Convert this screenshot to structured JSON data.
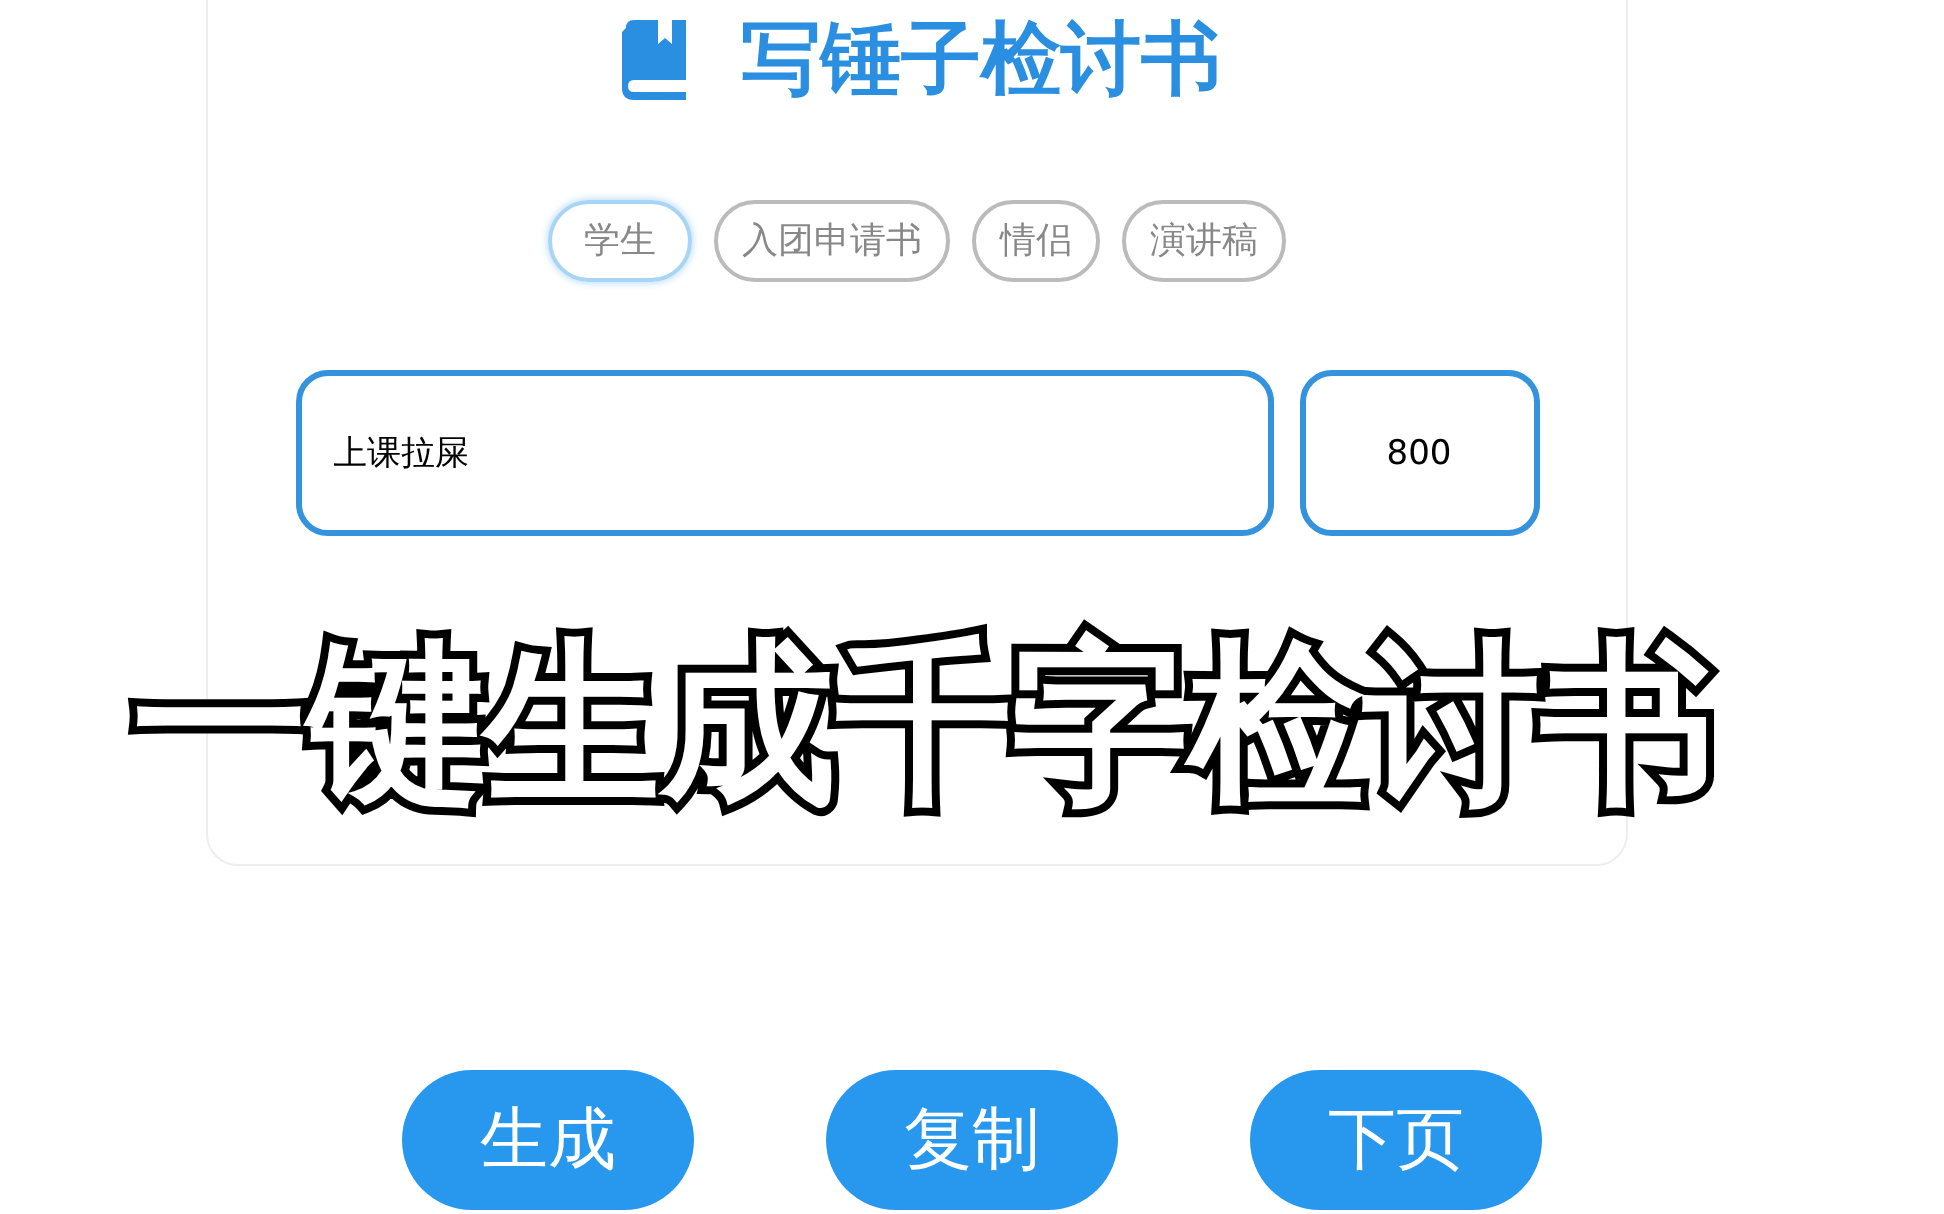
{
  "app": {
    "title": "写锤子检讨书"
  },
  "tabs": [
    {
      "label": "学生",
      "selected": true
    },
    {
      "label": "入团申请书",
      "selected": false
    },
    {
      "label": "情侣",
      "selected": false
    },
    {
      "label": "演讲稿",
      "selected": false
    }
  ],
  "topic_field": {
    "value": "上课拉屎"
  },
  "word_count_field": {
    "value": "800"
  },
  "caption": "一键生成千字检讨书",
  "buttons": [
    "生成",
    "复制",
    "下页"
  ]
}
